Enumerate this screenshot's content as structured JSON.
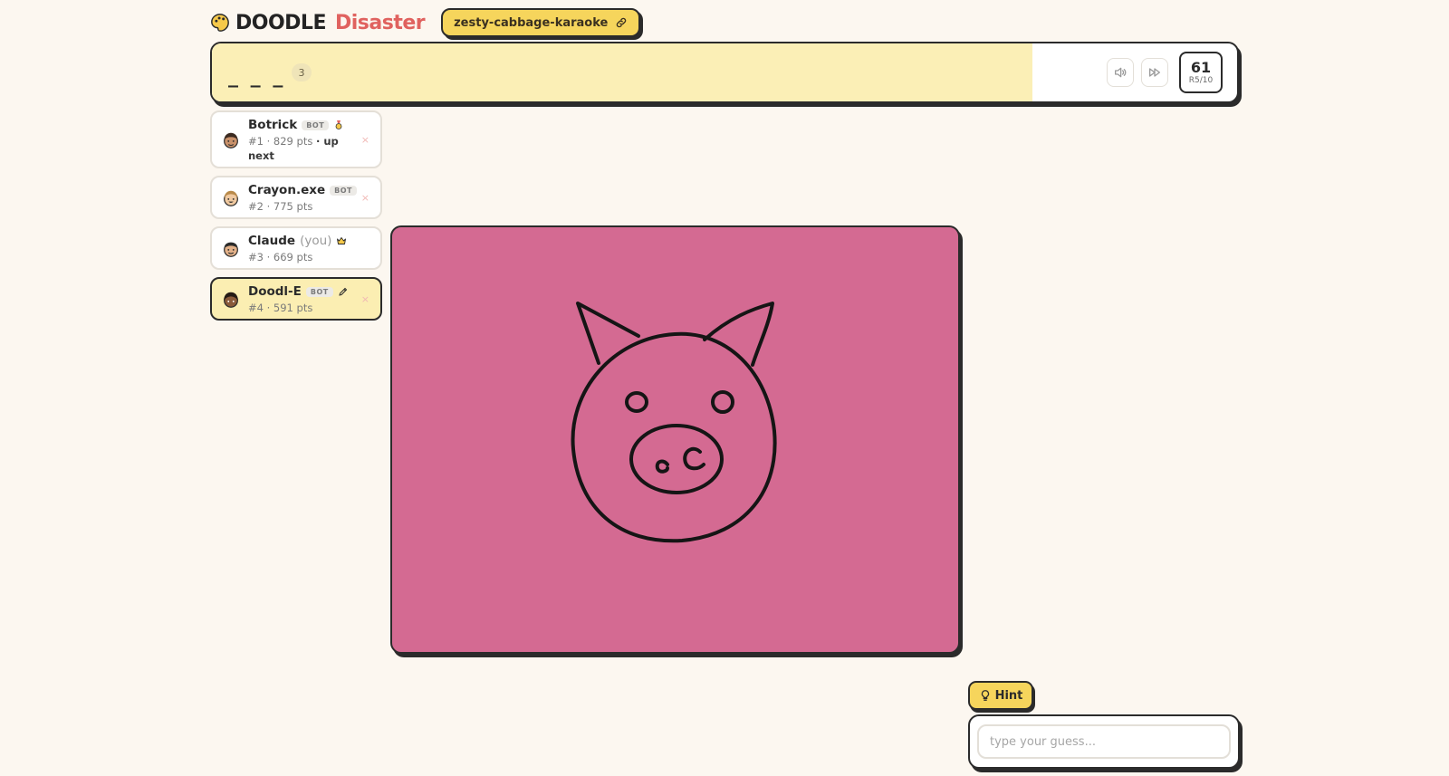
{
  "header": {
    "logo_part1": "DOODLE",
    "logo_part2": "Disaster",
    "room_name": "zesty-cabbage-karaoke"
  },
  "wordbar": {
    "blanks": "_ _ _",
    "letter_count": "3",
    "timer_seconds": "61",
    "round": "R5/10",
    "time_remaining_fraction": 0.8
  },
  "players": [
    {
      "name": "Botrick",
      "is_bot": true,
      "bot_label": "BOT",
      "rank_pts": "#1 · 829 pts",
      "status": "· up next",
      "icon": "medal-icon",
      "kick": "×"
    },
    {
      "name": "Crayon.exe",
      "is_bot": true,
      "bot_label": "BOT",
      "rank_pts": "#2 · 775 pts",
      "kick": "×"
    },
    {
      "name": "Claude",
      "you_label": "(you)",
      "is_bot": false,
      "rank_pts": "#3 · 669 pts",
      "icon": "crown-icon"
    },
    {
      "name": "Doodl-E",
      "is_bot": true,
      "bot_label": "BOT",
      "rank_pts": "#4 · 591 pts",
      "icon": "pencil-icon",
      "drawing": true,
      "kick": "×"
    }
  ],
  "guess": {
    "hint_label": "Hint",
    "placeholder": "type your guess..."
  },
  "colors": {
    "background": "#fcf7f0",
    "accent_yellow": "#f6d55c",
    "wordbar_fill": "#fbefb6",
    "canvas_bg": "#d46a92",
    "logo_red": "#e0625f",
    "border": "#2b2b2b"
  }
}
